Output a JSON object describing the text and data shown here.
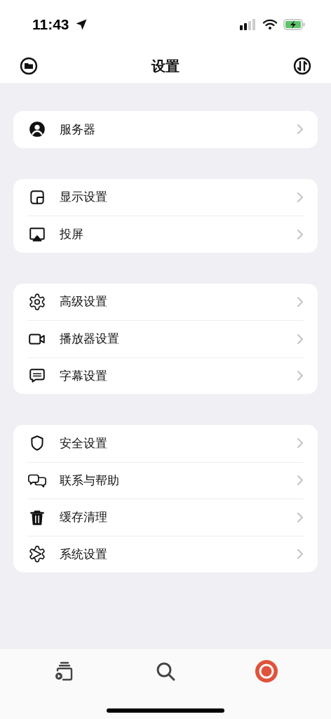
{
  "status_bar": {
    "time": "11:43"
  },
  "nav_bar": {
    "title": "设置"
  },
  "groups": [
    {
      "items": [
        {
          "label": "服务器",
          "kind": "person"
        }
      ]
    },
    {
      "items": [
        {
          "label": "显示设置",
          "kind": "window"
        },
        {
          "label": "投屏",
          "kind": "airplay"
        }
      ]
    },
    {
      "items": [
        {
          "label": "高级设置",
          "kind": "gear"
        },
        {
          "label": "播放器设置",
          "kind": "video"
        },
        {
          "label": "字幕设置",
          "kind": "caption"
        }
      ]
    },
    {
      "items": [
        {
          "label": "安全设置",
          "kind": "shield"
        },
        {
          "label": "联系与帮助",
          "kind": "chat"
        },
        {
          "label": "缓存清理",
          "kind": "trash"
        },
        {
          "label": "系统设置",
          "kind": "system"
        }
      ]
    }
  ],
  "tab_bar": [
    {
      "kind": "media",
      "selected": false
    },
    {
      "kind": "search",
      "selected": false
    },
    {
      "kind": "profile",
      "selected": true
    }
  ]
}
